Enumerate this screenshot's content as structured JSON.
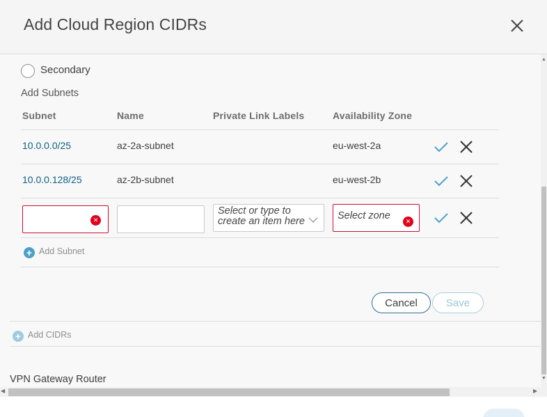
{
  "dialog": {
    "title": "Add Cloud Region CIDRs"
  },
  "secondary_option": {
    "label": "Secondary"
  },
  "subnets": {
    "section_label": "Add Subnets",
    "columns": [
      "Subnet",
      "Name",
      "Private Link Labels",
      "Availability Zone"
    ],
    "rows": [
      {
        "subnet": "10.0.0.0/25",
        "name": "az-2a-subnet",
        "private_link_labels": "",
        "availability_zone": "eu-west-2a"
      },
      {
        "subnet": "10.0.0.128/25",
        "name": "az-2b-subnet",
        "private_link_labels": "",
        "availability_zone": "eu-west-2b"
      }
    ],
    "new_row": {
      "subnet_value": "",
      "name_value": "",
      "private_link_placeholder": "Select or type to create an item here",
      "zone_placeholder": "Select zone"
    },
    "add_subnet_label": "Add Subnet"
  },
  "actions": {
    "cancel_label": "Cancel",
    "save_label": "Save"
  },
  "add_cidrs_label": "Add CIDRs",
  "vpn_gateway_label": "VPN Gateway Router",
  "colors": {
    "accent": "#0d5f86",
    "check": "#4d9fc8",
    "error": "#e2001a"
  }
}
